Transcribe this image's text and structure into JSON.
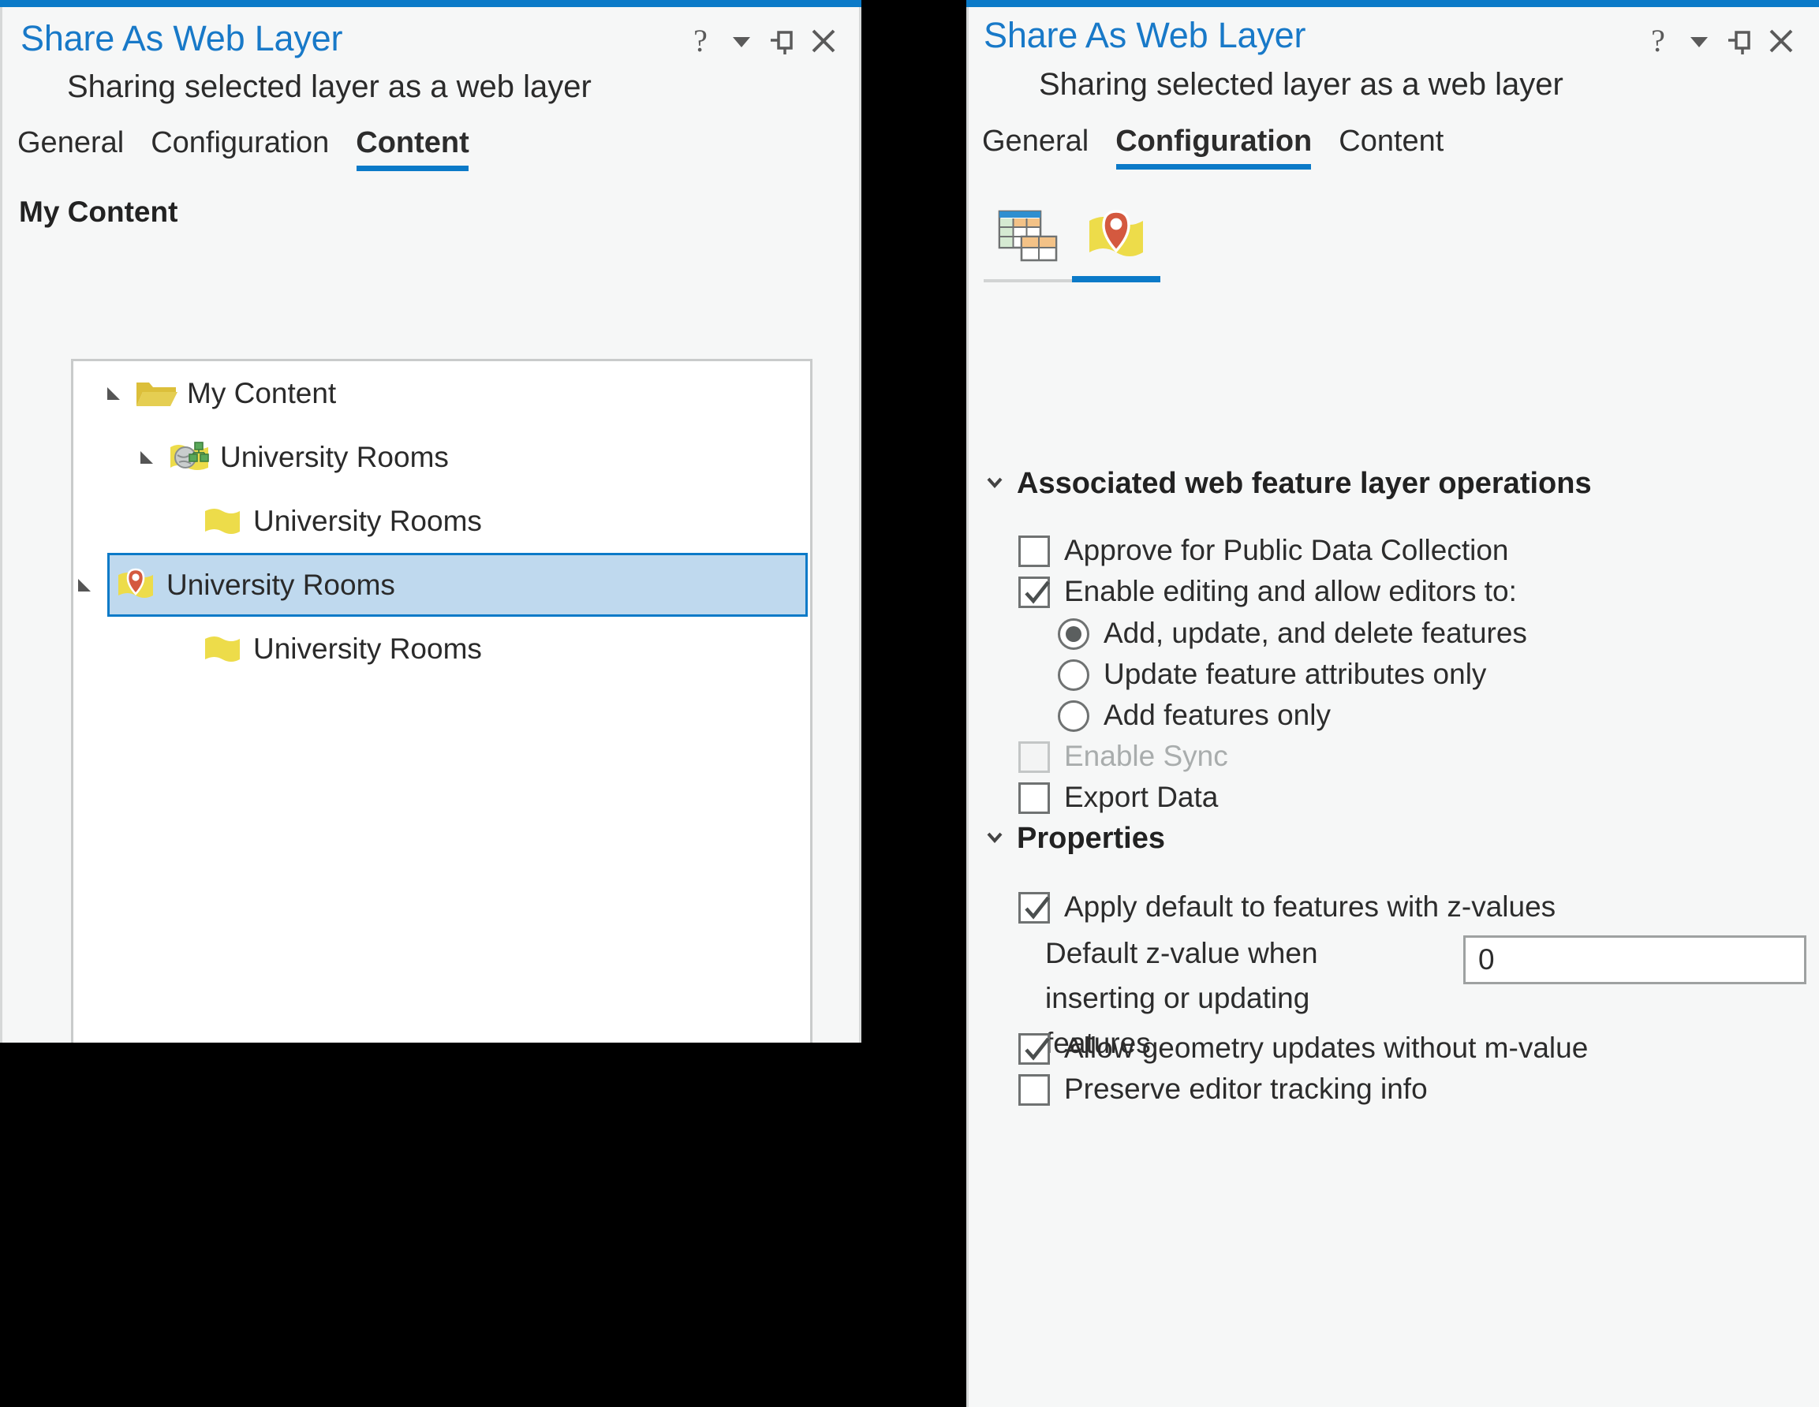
{
  "colors": {
    "accent": "#0b7ac8",
    "title_text": "#1879c8",
    "panel_bg": "#f6f7f7",
    "tree_bg": "#ffffff",
    "selection_fill": "#bfd9ee",
    "selection_border": "#0b7ac8",
    "folder_yellow": "#e4c23c",
    "map_yellow": "#eddc4a",
    "pin_red": "#d4593f",
    "node_green": "#4e9a4e",
    "disabled_text": "#a9adad"
  },
  "left_panel": {
    "title": "Share As Web Layer",
    "subtitle": "Sharing selected layer as a web layer",
    "window_controls": [
      {
        "name": "help-icon",
        "glyph": "?"
      },
      {
        "name": "menu-chevron-icon",
        "glyph": "▾"
      },
      {
        "name": "pin-icon",
        "glyph": "pin"
      },
      {
        "name": "close-icon",
        "glyph": "✕"
      }
    ],
    "tabs": [
      {
        "label": "General",
        "active": false
      },
      {
        "label": "Configuration",
        "active": false
      },
      {
        "label": "Content",
        "active": true
      }
    ],
    "content_heading": "My Content",
    "tree": [
      {
        "label": "My Content",
        "icon": "folder-icon",
        "indent": 0,
        "expander": "expanded",
        "selected": false
      },
      {
        "label": "University Rooms",
        "icon": "web-feature-layer-icon",
        "indent": 1,
        "expander": "expanded",
        "selected": false
      },
      {
        "label": "University Rooms",
        "icon": "map-layer-icon",
        "indent": 2,
        "expander": "none",
        "selected": false
      },
      {
        "label": "University Rooms",
        "icon": "map-pin-layer-icon",
        "indent": 1,
        "expander": "expanded",
        "selected": true
      },
      {
        "label": "University Rooms",
        "icon": "map-layer-icon",
        "indent": 2,
        "expander": "none",
        "selected": false
      }
    ]
  },
  "right_panel": {
    "title": "Share As Web Layer",
    "subtitle": "Sharing selected layer as a web layer",
    "window_controls": [
      {
        "name": "help-icon",
        "glyph": "?"
      },
      {
        "name": "menu-chevron-icon",
        "glyph": "▾"
      },
      {
        "name": "pin-icon",
        "glyph": "pin"
      },
      {
        "name": "close-icon",
        "glyph": "✕"
      }
    ],
    "tabs": [
      {
        "label": "General",
        "active": false
      },
      {
        "label": "Configuration",
        "active": true
      },
      {
        "label": "Content",
        "active": false
      }
    ],
    "icon_tabs": [
      {
        "name": "web-feature-layer-tab-icon",
        "active": false
      },
      {
        "name": "map-pin-layer-tab-icon",
        "active": true
      }
    ],
    "groups": [
      {
        "heading": "Associated web feature layer operations",
        "expanded": true,
        "options": [
          {
            "type": "checkbox",
            "label": "Approve for Public Data Collection",
            "checked": false,
            "disabled": false
          },
          {
            "type": "checkbox",
            "label": "Enable editing and allow editors to:",
            "checked": true,
            "disabled": false
          },
          {
            "type": "radio",
            "label": "Add, update, and delete features",
            "checked": true,
            "disabled": false
          },
          {
            "type": "radio",
            "label": "Update feature attributes only",
            "checked": false,
            "disabled": false
          },
          {
            "type": "radio",
            "label": "Add features only",
            "checked": false,
            "disabled": false
          },
          {
            "type": "checkbox",
            "label": "Enable Sync",
            "checked": false,
            "disabled": true
          },
          {
            "type": "checkbox",
            "label": "Export Data",
            "checked": false,
            "disabled": false
          }
        ]
      },
      {
        "heading": "Properties",
        "expanded": true,
        "options": [
          {
            "type": "checkbox",
            "label": "Apply default to features with z-values",
            "checked": true,
            "disabled": false
          },
          {
            "type": "field",
            "label": "Default z-value when inserting or updating features",
            "value": "0"
          },
          {
            "type": "checkbox",
            "label": "Allow geometry updates without m-value",
            "checked": true,
            "disabled": false
          },
          {
            "type": "checkbox",
            "label": "Preserve editor tracking info",
            "checked": false,
            "disabled": false
          }
        ]
      }
    ]
  }
}
